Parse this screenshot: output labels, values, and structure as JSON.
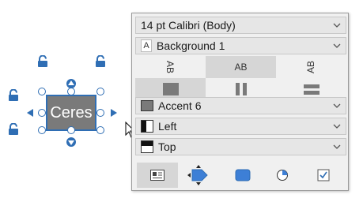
{
  "canvas": {
    "shape_text": "Ceres",
    "colors": {
      "shape_fill": "#7a7a7a",
      "selection": "#2f6eb4",
      "lock": "#2f6eb4"
    }
  },
  "panel": {
    "font_dropdown": {
      "value": "14 pt Calibri (Body)"
    },
    "text_color_dropdown": {
      "icon": "text-color-icon",
      "icon_letter": "A",
      "value": "Background 1"
    },
    "text_direction": {
      "options": [
        {
          "label": "AB",
          "icon": "text-rotate-left-icon",
          "selected": false
        },
        {
          "label": "AB",
          "icon": "text-horizontal-icon",
          "selected": true
        },
        {
          "label": "AB",
          "icon": "text-rotate-right-icon",
          "selected": false
        }
      ]
    },
    "layout_options": [
      {
        "icon": "square-fill-icon",
        "selected": true
      },
      {
        "icon": "vertical-bars-icon",
        "selected": false
      },
      {
        "icon": "horizontal-bars-icon",
        "selected": false
      }
    ],
    "fill_dropdown": {
      "value": "Accent 6",
      "swatch_color": "#7a7a7a"
    },
    "align_dropdown": {
      "value": "Left",
      "icon": "align-left-icon"
    },
    "valign_dropdown": {
      "value": "Top",
      "icon": "align-top-icon"
    },
    "tabs": [
      {
        "name": "text-tab",
        "icon": "text-box-icon",
        "selected": true
      },
      {
        "name": "shape-tab",
        "icon": "shape-move-icon",
        "selected": false
      },
      {
        "name": "fill-tab",
        "icon": "rounded-rect-icon",
        "selected": false
      },
      {
        "name": "pie-tab",
        "icon": "pie-icon",
        "selected": false
      },
      {
        "name": "checkbox-tab",
        "icon": "checkbox-icon",
        "selected": false
      }
    ]
  }
}
